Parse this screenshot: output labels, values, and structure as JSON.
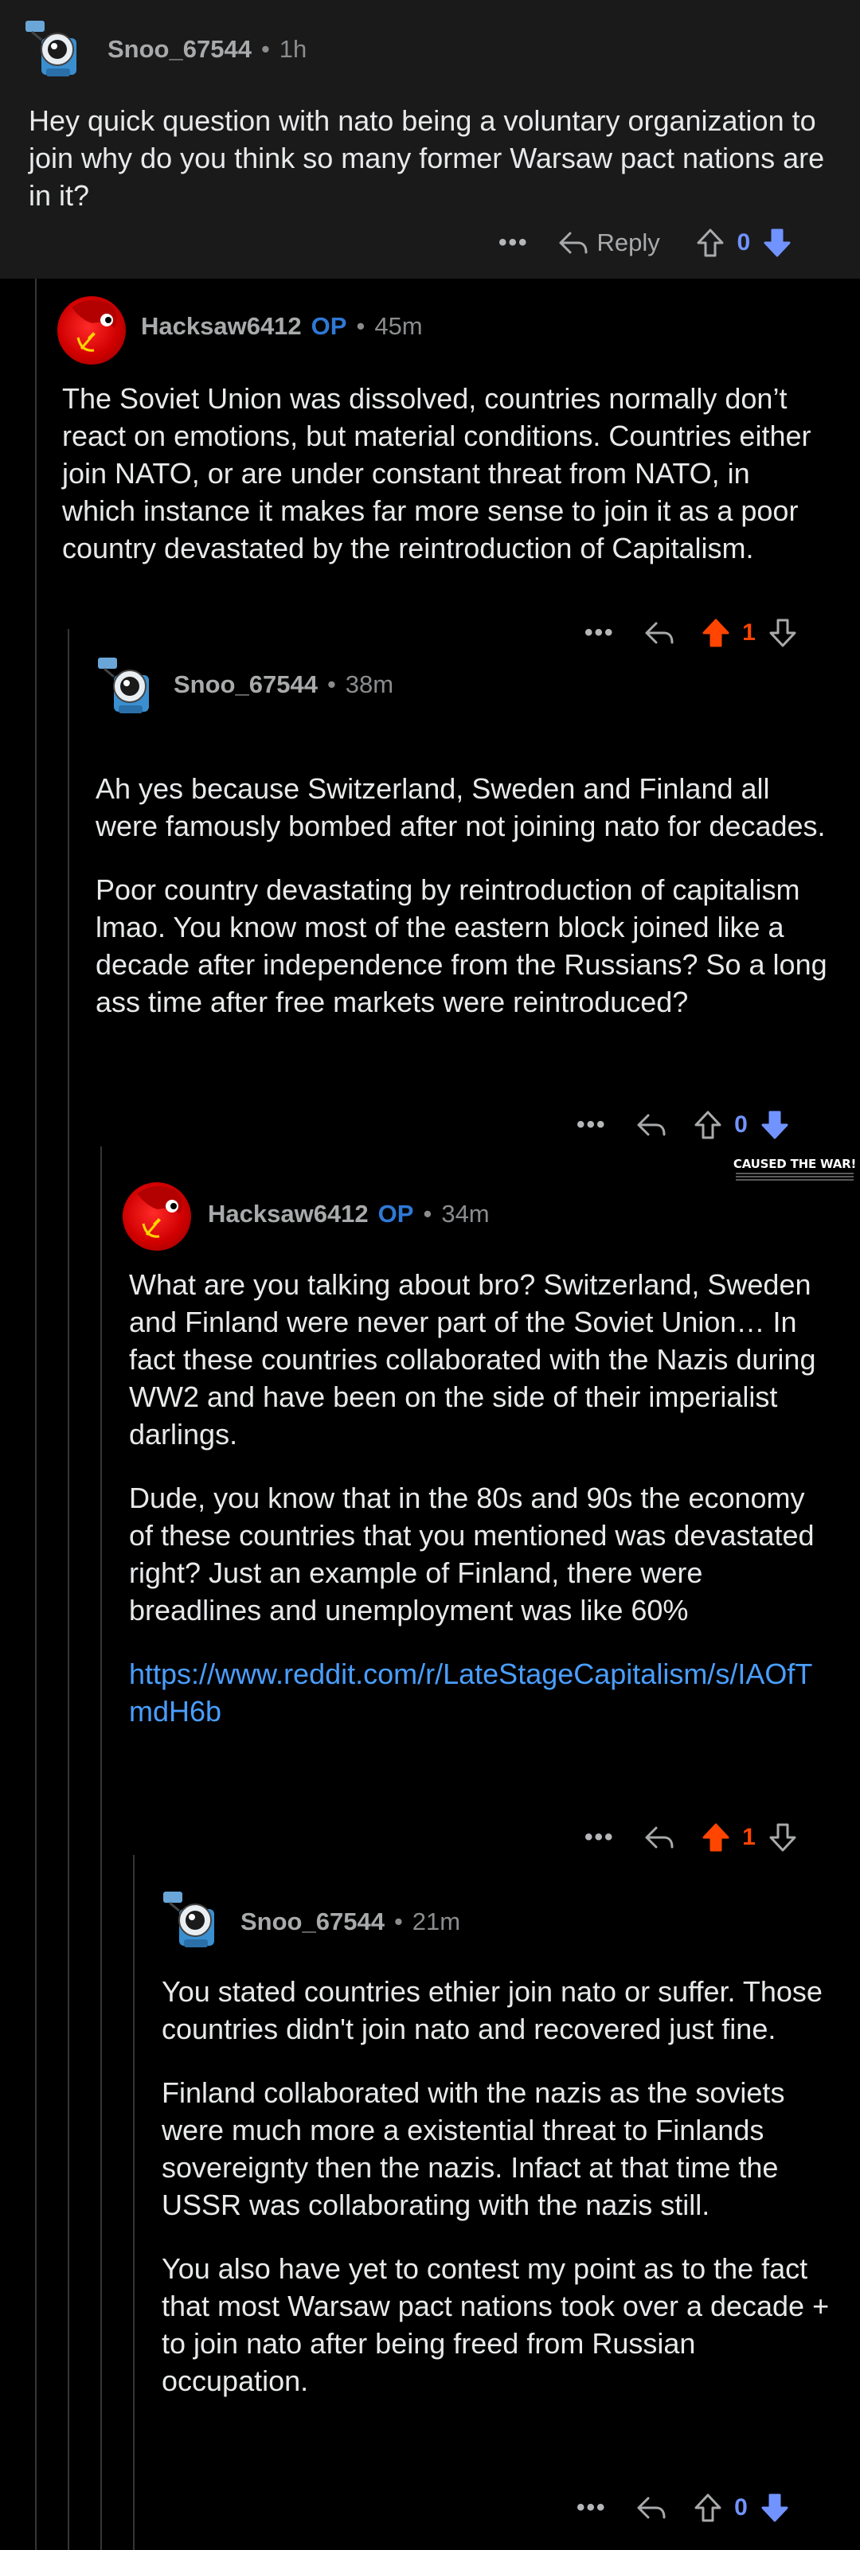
{
  "comments": [
    {
      "user": "Snoo_67544",
      "op": "",
      "separator": "•",
      "time": "1h",
      "paragraphs": [
        "Hey quick question with nato being a voluntary organization to join why do you think so many former Warsaw pact nations are in it?"
      ],
      "more": "•••",
      "reply": "Reply",
      "score": "0",
      "upvoted": false,
      "downvoted": true
    },
    {
      "user": "Hacksaw6412",
      "op": "OP",
      "separator": "•",
      "time": "45m",
      "paragraphs": [
        "The Soviet Union was dissolved, countries normally don’t react on emotions, but material conditions. Countries either join NATO, or are under constant threat from NATO, in which instance it makes far more sense to join it as a poor country devastated by the reintroduction of Capitalism."
      ],
      "more": "•••",
      "score": "1",
      "upvoted": true,
      "downvoted": false
    },
    {
      "user": "Snoo_67544",
      "op": "",
      "separator": "•",
      "time": "38m",
      "paragraphs": [
        "Ah yes because Switzerland, Sweden and Finland all were famously bombed after not joining nato for decades.",
        "Poor country devastating by reintroduction of capitalism lmao. You know most of the eastern block joined like a decade after independence from the Russians? So a long ass time after free markets were reintroduced?"
      ],
      "more": "•••",
      "score": "0",
      "upvoted": false,
      "downvoted": true
    },
    {
      "user": "Hacksaw6412",
      "op": "OP",
      "separator": "•",
      "time": "34m",
      "paragraphs": [
        "What are you talking about bro? Switzerland, Sweden and Finland were never part of the Soviet Union… In fact these countries collaborated with the Nazis during WW2 and have been on the side of their imperialist darlings.",
        "Dude, you know that in the 80s and 90s the economy of these countries that you mentioned was devastated right? Just an example of Finland, there were breadlines and unemployment was like 60%"
      ],
      "link": "https://www.reddit.com/r/LateStageCapitalism/s/IAOfTmdH6b",
      "more": "•••",
      "score": "1",
      "upvoted": true,
      "downvoted": false
    },
    {
      "user": "Snoo_67544",
      "op": "",
      "separator": "•",
      "time": "21m",
      "paragraphs": [
        "You stated countries ethier join nato or suffer. Those countries didn't join nato and recovered just fine.",
        "Finland collaborated with the nazis as the soviets were much more a existential threat to Finlands sovereignty then the nazis. Infact at that time the USSR was collaborating with the nazis still.",
        "You also have yet to contest my point as to the fact that most Warsaw pact nations took over a decade + to join nato after being freed from Russian occupation."
      ],
      "more": "•••",
      "score": "0",
      "upvoted": false,
      "downvoted": true
    }
  ],
  "overlay": {
    "caption": "CAUSED THE WAR!"
  },
  "colors": {
    "upvote_active": "#ff4500",
    "downvote_active": "#7193ff",
    "op": "#2f79d6",
    "link": "#4a9eff",
    "thread_bg": "#1a1a1b"
  }
}
